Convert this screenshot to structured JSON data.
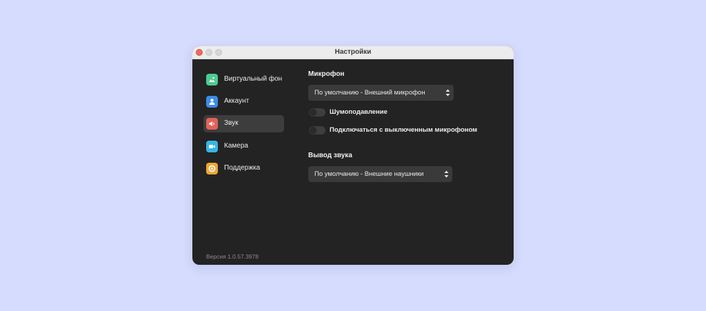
{
  "window": {
    "title": "Настройки"
  },
  "sidebar": {
    "items": [
      {
        "label": "Виртуальный фон",
        "icon": "image-icon",
        "color": "#4ecb8f",
        "active": false
      },
      {
        "label": "Аккаунт",
        "icon": "user-icon",
        "color": "#3d8be8",
        "active": false
      },
      {
        "label": "Звук",
        "icon": "speaker-icon",
        "color": "#e3615a",
        "active": true
      },
      {
        "label": "Камера",
        "icon": "camera-icon",
        "color": "#36b6e6",
        "active": false
      },
      {
        "label": "Поддержка",
        "icon": "lifebuoy-icon",
        "color": "#f0a632",
        "active": false
      }
    ],
    "version": "Версия 1.0.57.3978"
  },
  "microphone": {
    "title": "Микрофон",
    "selected": "По умолчанию - Внешний микрофон",
    "toggles": [
      {
        "label": "Шумоподавление",
        "enabled": false
      },
      {
        "label": "Подключаться с выключенным микрофоном",
        "enabled": false
      }
    ]
  },
  "output": {
    "title": "Вывод звука",
    "selected": "По умолчанию - Внешние наушники"
  },
  "colors": {
    "background": "#d5dcfd",
    "window": "#232323",
    "titlebar": "#ececec",
    "active_item": "#3d3d3d",
    "control": "#3a3a3a"
  }
}
